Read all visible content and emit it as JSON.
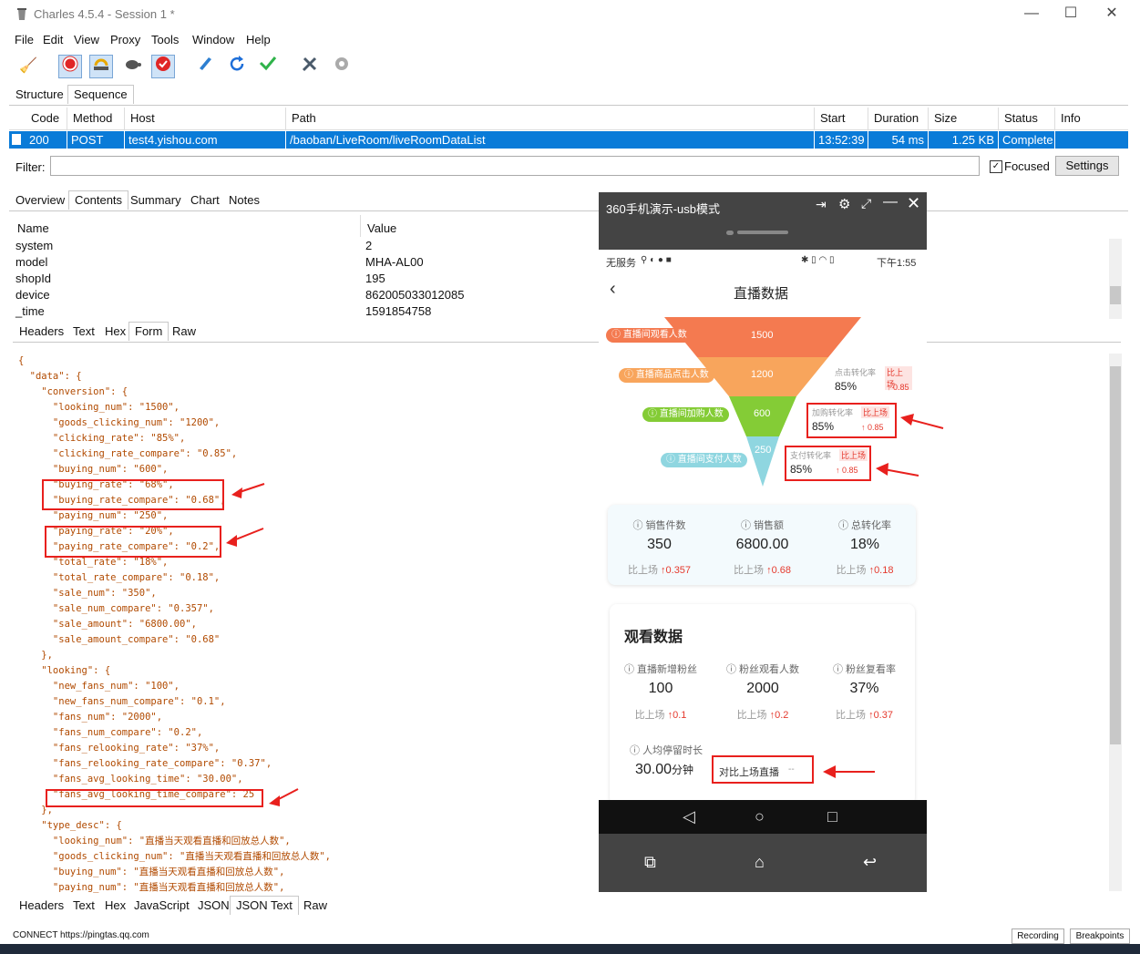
{
  "window": {
    "title": "Charles 4.5.4 - Session 1 *"
  },
  "menu": [
    "File",
    "Edit",
    "View",
    "Proxy",
    "Tools",
    "Window",
    "Help"
  ],
  "views": {
    "structure": "Structure",
    "sequence": "Sequence"
  },
  "table": {
    "headers": [
      "Code",
      "Method",
      "Host",
      "Path",
      "Start",
      "Duration",
      "Size",
      "Status",
      "Info"
    ],
    "row": {
      "code": "200",
      "method": "POST",
      "host": "test4.yishou.com",
      "path": "/baoban/LiveRoom/liveRoomDataList",
      "start": "13:52:39",
      "duration": "54 ms",
      "size": "1.25 KB",
      "status": "Complete",
      "info": ""
    }
  },
  "filter": {
    "label": "Filter:",
    "value": "",
    "focused": "Focused",
    "settings": "Settings"
  },
  "detail_tabs": [
    "Overview",
    "Contents",
    "Summary",
    "Chart",
    "Notes"
  ],
  "kv": {
    "name_header": "Name",
    "value_header": "Value",
    "rows": [
      {
        "name": "system",
        "value": "2"
      },
      {
        "name": "model",
        "value": "MHA-AL00"
      },
      {
        "name": "shopId",
        "value": "195"
      },
      {
        "name": "device",
        "value": "862005033012085"
      },
      {
        "name": "_time",
        "value": "1591854758"
      }
    ]
  },
  "request_tabs": [
    "Headers",
    "Text",
    "Hex",
    "Form",
    "Raw"
  ],
  "response_tabs": [
    "Headers",
    "Text",
    "Hex",
    "JavaScript",
    "JSON",
    "JSON Text",
    "Raw"
  ],
  "json_lines": [
    "{",
    "  \"data\": {",
    "    \"conversion\": {",
    "      \"looking_num\": \"1500\",",
    "      \"goods_clicking_num\": \"1200\",",
    "      \"clicking_rate\": \"85%\",",
    "      \"clicking_rate_compare\": \"0.85\",",
    "      \"buying_num\": \"600\",",
    "      \"buying_rate\": \"68%\",",
    "      \"buying_rate_compare\": \"0.68\",",
    "      \"paying_num\": \"250\",",
    "      \"paying_rate\": \"20%\",",
    "      \"paying_rate_compare\": \"0.2\",",
    "      \"total_rate\": \"18%\",",
    "      \"total_rate_compare\": \"0.18\",",
    "      \"sale_num\": \"350\",",
    "      \"sale_num_compare\": \"0.357\",",
    "      \"sale_amount\": \"6800.00\",",
    "      \"sale_amount_compare\": \"0.68\"",
    "    },",
    "    \"looking\": {",
    "      \"new_fans_num\": \"100\",",
    "      \"new_fans_num_compare\": \"0.1\",",
    "      \"fans_num\": \"2000\",",
    "      \"fans_num_compare\": \"0.2\",",
    "      \"fans_relooking_rate\": \"37%\",",
    "      \"fans_relooking_rate_compare\": \"0.37\",",
    "      \"fans_avg_looking_time\": \"30.00\",",
    "      \"fans_avg_looking_time_compare\": 25",
    "    },",
    "    \"type_desc\": {",
    "      \"looking_num\": \"直播当天观看直播和回放总人数\",",
    "      \"goods_clicking_num\": \"直播当天观看直播和回放总人数\",",
    "      \"buying_num\": \"直播当天观看直播和回放总人数\",",
    "      \"paying_num\": \"直播当天观看直播和回放总人数\","
  ],
  "status": {
    "left": "CONNECT https://pingtas.qq.com",
    "recording": "Recording",
    "breakpoints": "Breakpoints"
  },
  "phone": {
    "window_title": "360手机演示-usb模式",
    "statusbar_left": "无服务",
    "statusbar_right": "下午1:55",
    "page_title": "直播数据",
    "funnel": [
      {
        "label": "直播间观看人数",
        "value": "1500",
        "color": "#f47a50"
      },
      {
        "label": "直播商品点击人数",
        "value": "1200",
        "color": "#f8a55c"
      },
      {
        "label": "直播间加购人数",
        "value": "600",
        "color": "#84cc36"
      },
      {
        "label": "直播间支付人数",
        "value": "250",
        "color": "#8fd6e0"
      }
    ],
    "rates": [
      {
        "label": "点击转化率",
        "tag": "比上场",
        "value": "85%",
        "cmp": "0.85"
      },
      {
        "label": "加购转化率",
        "tag": "比上场",
        "value": "85%",
        "cmp": "0.85"
      },
      {
        "label": "支付转化率",
        "tag": "比上场",
        "value": "85%",
        "cmp": "0.85"
      }
    ],
    "sales": [
      {
        "label": "销售件数",
        "value": "350",
        "cmp_label": "比上场",
        "cmp": "0.357"
      },
      {
        "label": "销售额",
        "value": "6800.00",
        "cmp_label": "比上场",
        "cmp": "0.68"
      },
      {
        "label": "总转化率",
        "value": "18%",
        "cmp_label": "比上场",
        "cmp": "0.18"
      }
    ],
    "watch_title": "观看数据",
    "watch": [
      {
        "label": "直播新增粉丝",
        "value": "100",
        "cmp_label": "比上场",
        "cmp": "0.1"
      },
      {
        "label": "粉丝观看人数",
        "value": "2000",
        "cmp_label": "比上场",
        "cmp": "0.2"
      },
      {
        "label": "粉丝复看率",
        "value": "37%",
        "cmp_label": "比上场",
        "cmp": "0.37"
      }
    ],
    "stay": {
      "label": "人均停留时长",
      "value": "30.00",
      "unit": "分钟",
      "compare": "对比上场直播",
      "compare_value": "--"
    }
  },
  "colors": {
    "selection": "#0a7bd8",
    "highlight": "#e8201d",
    "arrow": "#e8201d",
    "up": "#e53a2e"
  }
}
